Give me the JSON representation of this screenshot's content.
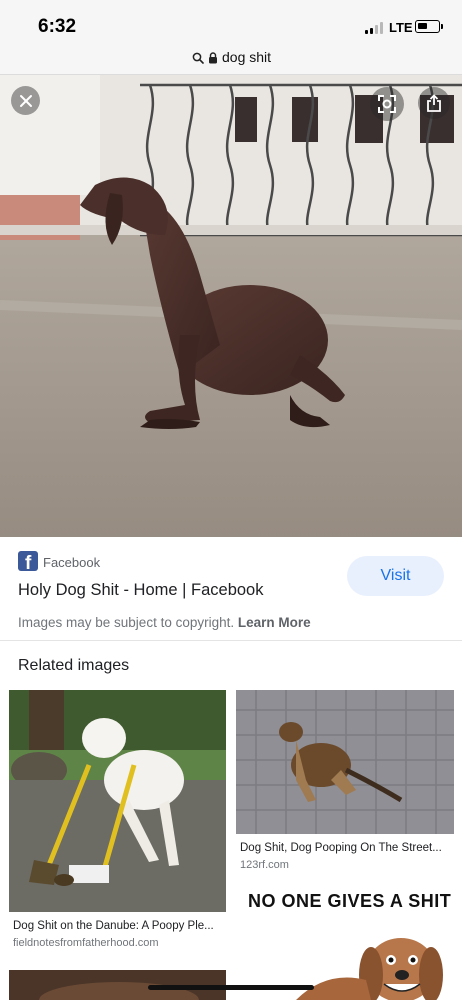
{
  "status_bar": {
    "time": "6:32",
    "network": "LTE"
  },
  "url_bar": {
    "text": "dog shit"
  },
  "icons": {
    "close": "close-icon",
    "lens": "lens-icon",
    "share": "share-icon",
    "search": "search-icon",
    "lock": "lock-icon",
    "source": "facebook-icon"
  },
  "result": {
    "source_name": "Facebook",
    "title": "Holy Dog Shit - Home | Facebook",
    "visit_label": "Visit",
    "copyright_text": "Images may be subject to copyright.",
    "learn_more_label": "Learn More"
  },
  "related": {
    "heading": "Related images",
    "items": [
      {
        "title": "Dog Shit on the Danube: A Poopy Ple...",
        "source": "fieldnotesfromfatherhood.com"
      },
      {
        "title": "Dog Shit, Dog Pooping On The Street...",
        "source": "123rf.com"
      },
      {
        "caption_in_image": "NO ONE GIVES A SHIT"
      }
    ]
  },
  "colors": {
    "accent": "#1a73e8",
    "visit_bg": "#e8f0fe",
    "facebook": "#3b5998"
  }
}
